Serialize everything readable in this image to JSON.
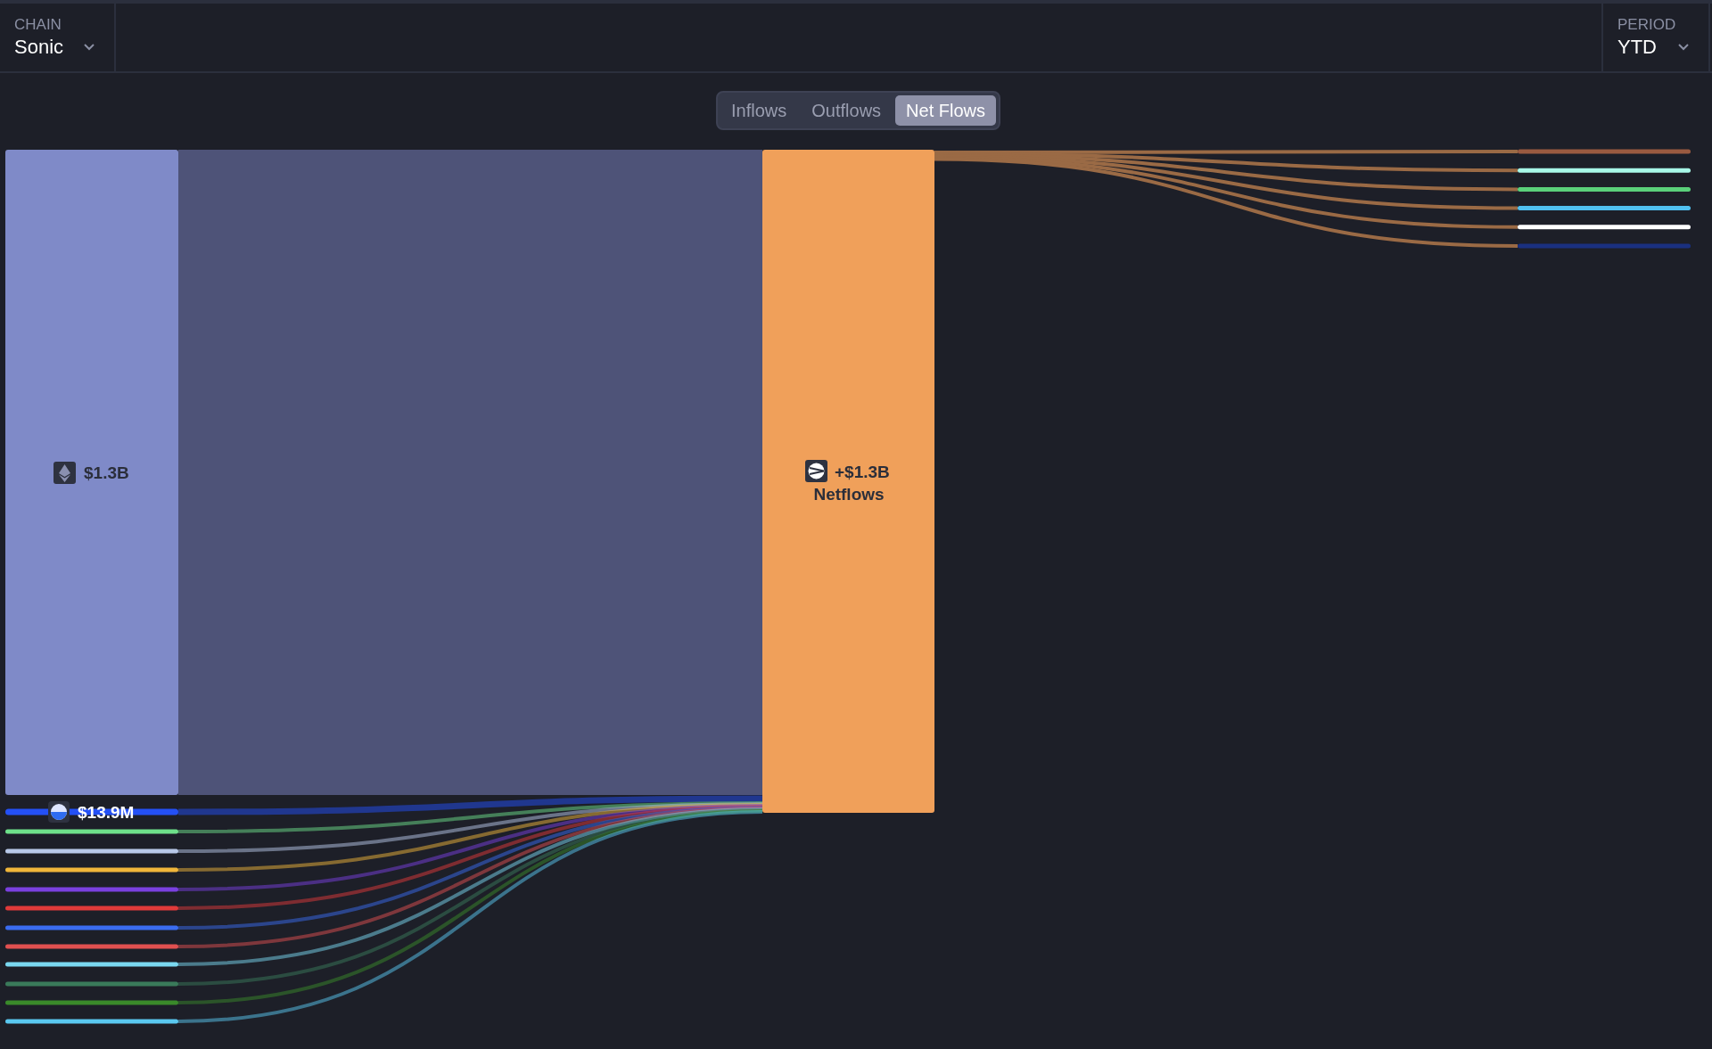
{
  "header": {
    "chain": {
      "label": "CHAIN",
      "value": "Sonic"
    },
    "period": {
      "label": "PERIOD",
      "value": "YTD"
    }
  },
  "view_toggle": [
    {
      "label": "Inflows",
      "selected": false
    },
    {
      "label": "Outflows",
      "selected": false
    },
    {
      "label": "Net Flows",
      "selected": true
    }
  ],
  "sankey": {
    "source_main": {
      "label": "$1.3B"
    },
    "center": {
      "value": "+$1.3B",
      "label": "Netflows"
    },
    "sources": [
      {
        "color": "#2450f5",
        "label": "$13.9M"
      },
      {
        "color": "#6ee08a"
      },
      {
        "color": "#b8c8e8"
      },
      {
        "color": "#f0b63a"
      },
      {
        "color": "#7a40e0"
      },
      {
        "color": "#e03a3a"
      },
      {
        "color": "#3a6cf0"
      },
      {
        "color": "#e05050"
      },
      {
        "color": "#7ad8f0"
      },
      {
        "color": "#3a7a5a"
      },
      {
        "color": "#3a8a2a"
      },
      {
        "color": "#5ac8f0"
      }
    ],
    "targets": [
      {
        "color": "#9a5a40"
      },
      {
        "color": "#a8f8e8"
      },
      {
        "color": "#5ad07a"
      },
      {
        "color": "#50c0f0"
      },
      {
        "color": "#ffffff"
      },
      {
        "color": "#1a3080"
      }
    ]
  }
}
